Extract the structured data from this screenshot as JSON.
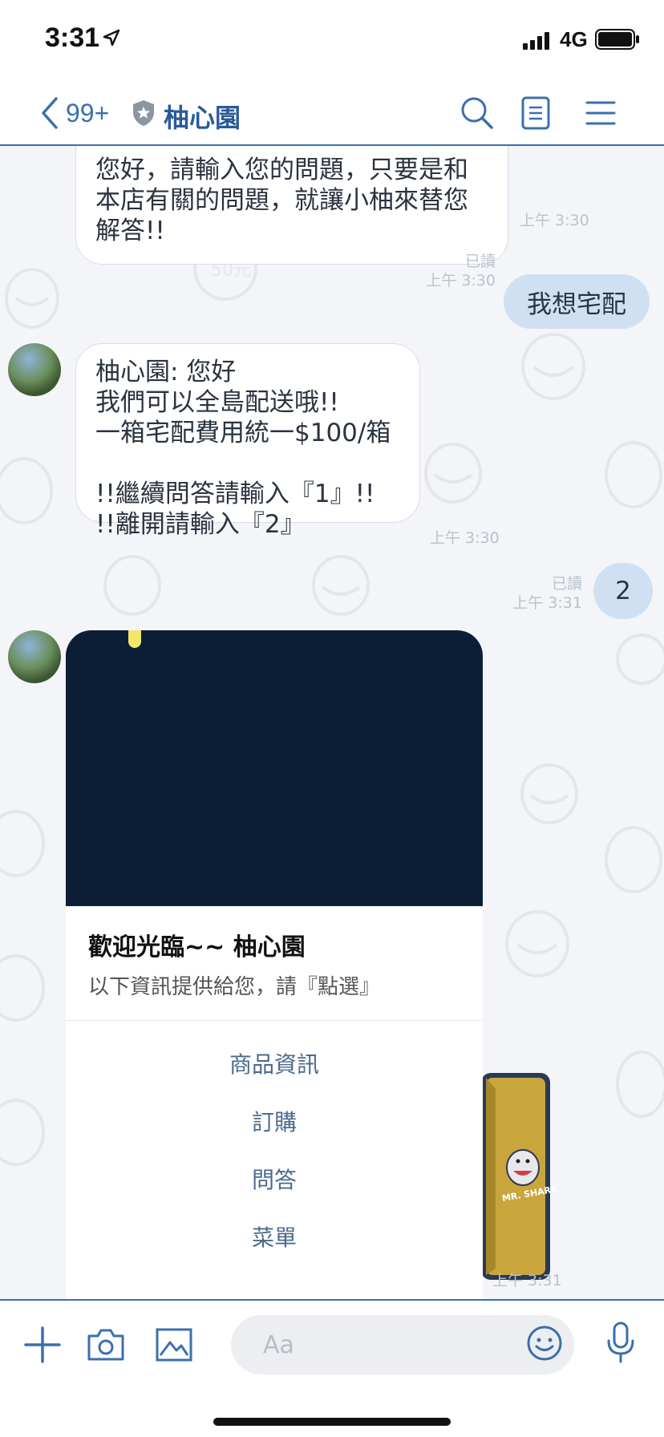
{
  "status_bar": {
    "time": "3:31",
    "network": "4G"
  },
  "header": {
    "back_count": "99+",
    "title": "柚心園"
  },
  "messages": {
    "m1": {
      "lines": [
        "您好，請輸入您的問題，只要是和",
        "本店有關的問題，就讓小柚來替您",
        "解答!!"
      ],
      "time": "上午 3:30"
    },
    "m2": {
      "text": "我想宅配",
      "read": "已讀",
      "time": "上午 3:30"
    },
    "m3": {
      "lines": [
        "柚心園: 您好",
        "我們可以全島配送哦!!",
        "一箱宅配費用統一$100/箱",
        "",
        "!!繼續問答請輸入『1』!!",
        "!!離開請輸入『2』"
      ],
      "time": "上午 3:30"
    },
    "m4": {
      "text": "2",
      "read": "已讀",
      "time": "上午 3:31"
    },
    "card": {
      "title": "歡迎光臨~~ 柚心園",
      "subtitle": "以下資訊提供給您，請『點選』",
      "actions": [
        "商品資訊",
        "訂購",
        "問答",
        "菜單"
      ],
      "time": "上午 3:31"
    },
    "sticker_text": "MR. SHARK"
  },
  "input": {
    "placeholder": "Aa"
  },
  "colors": {
    "accent": "#3b6fae",
    "self_bubble": "#cfe0f2",
    "card_image": "#0c1e36"
  }
}
